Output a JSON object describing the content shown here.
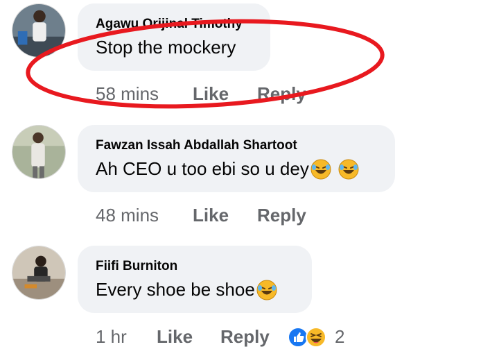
{
  "comments": [
    {
      "author": "Agawu Orijinal Timothy",
      "text": "Stop the mockery",
      "time": "58 mins",
      "like_label": "Like",
      "reply_label": "Reply"
    },
    {
      "author": "Fawzan Issah Abdallah Shartoot",
      "text": "Ah CEO u too ebi so u dey",
      "time": "48 mins",
      "like_label": "Like",
      "reply_label": "Reply"
    },
    {
      "author": "Fiifi Burniton",
      "text": "Every shoe be shoe",
      "time": "1 hr",
      "like_label": "Like",
      "reply_label": "Reply",
      "reaction_count": "2"
    }
  ],
  "colors": {
    "bubble_bg": "#f0f2f5",
    "meta_text": "#65676b",
    "highlight": "#e8191f",
    "like_blue": "#1877f2",
    "emoji_yellow": "#f7b928"
  },
  "icons": {
    "laugh": "laughing-emoji-icon",
    "like_reaction": "like-reaction-icon",
    "haha_reaction": "haha-reaction-icon"
  }
}
